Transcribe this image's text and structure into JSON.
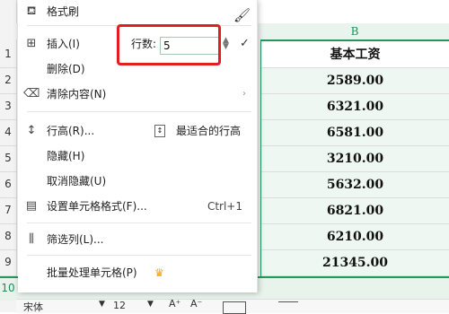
{
  "spreadsheet": {
    "column_b_header": "B",
    "row_numbers": [
      "1",
      "2",
      "3",
      "4",
      "5",
      "6",
      "7",
      "8",
      "9"
    ],
    "row_10_number": "10",
    "column_b_cells": [
      "基本工资",
      "2589.00",
      "6321.00",
      "6581.00",
      "3210.00",
      "5632.00",
      "6821.00",
      "6210.00",
      "21345.00"
    ]
  },
  "context_menu": {
    "format_painter": "格式刷",
    "insert": "插入(I)",
    "rows_label": "行数:",
    "rows_value": "5",
    "delete": "删除(D)",
    "clear_contents": "清除内容(N)",
    "row_height": "行高(R)...",
    "best_fit_row_height": "最适合的行高",
    "hide": "隐藏(H)",
    "unhide": "取消隐藏(U)",
    "format_cells": "设置单元格格式(F)...",
    "format_cells_shortcut": "Ctrl+1",
    "filter_column": "筛选列(L)...",
    "batch_process": "批量处理单元格(P)"
  },
  "font_toolbar": {
    "font_name": "宋体",
    "font_size": "12",
    "increase_font": "A⁺",
    "decrease_font": "A⁻"
  },
  "colors": {
    "accent_green": "#1f9a5a",
    "highlight_red": "#e02020",
    "crown_orange": "#f2a20b"
  }
}
